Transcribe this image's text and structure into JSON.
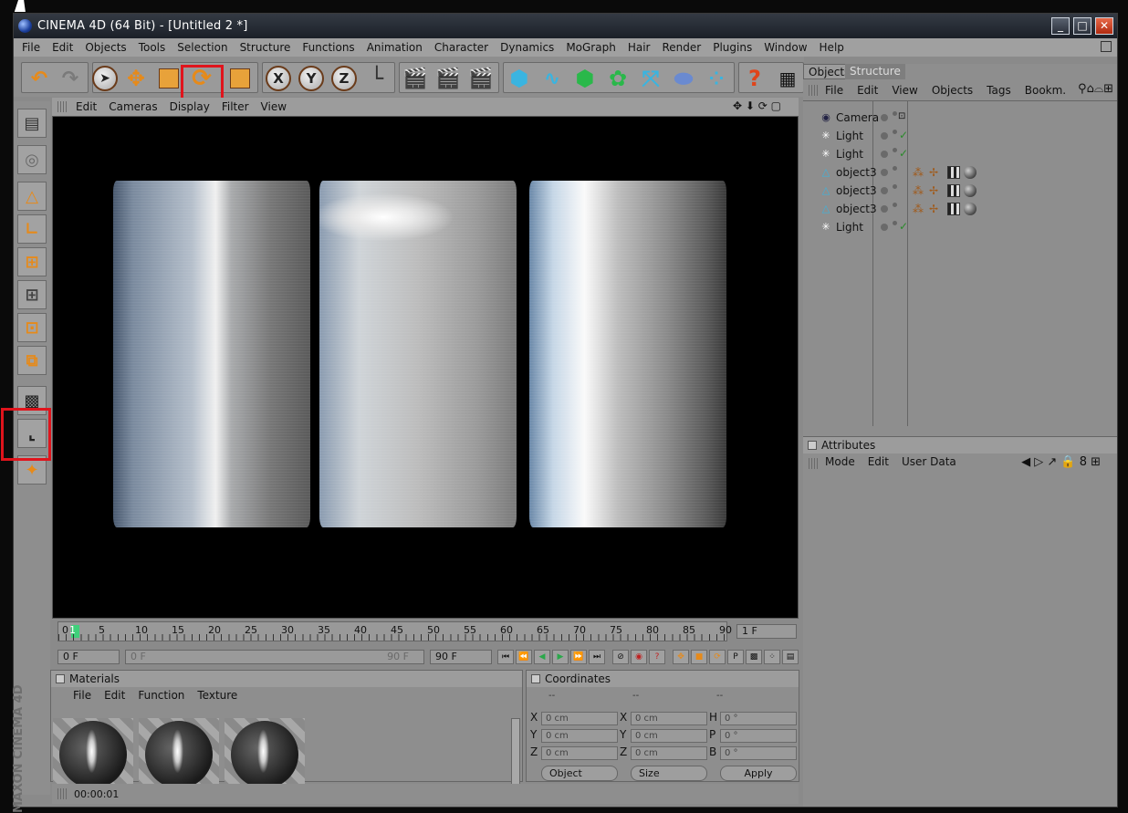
{
  "window": {
    "title": "CINEMA 4D (64 Bit) - [Untitled 2 *]",
    "minimize": "_",
    "maximize": "□",
    "close": "✕"
  },
  "menubar": [
    "File",
    "Edit",
    "Objects",
    "Tools",
    "Selection",
    "Structure",
    "Functions",
    "Animation",
    "Character",
    "Dynamics",
    "MoGraph",
    "Hair",
    "Render",
    "Plugins",
    "Window",
    "Help"
  ],
  "toolbar": {
    "axis_x": "X",
    "axis_y": "Y",
    "axis_z": "Z",
    "help_icon": "?"
  },
  "viewport": {
    "menu": [
      "Edit",
      "Cameras",
      "Display",
      "Filter",
      "View"
    ]
  },
  "timeline": {
    "ticks": [
      "0",
      "1",
      "5",
      "10",
      "15",
      "20",
      "25",
      "30",
      "35",
      "40",
      "45",
      "50",
      "55",
      "60",
      "65",
      "70",
      "75",
      "80",
      "85",
      "90"
    ],
    "current_frame": "1 F",
    "start": "0 F",
    "range_start": "0 F",
    "range_end": "90 F",
    "end": "90 F",
    "key_p": "P"
  },
  "materials": {
    "title": "Materials",
    "menu": [
      "File",
      "Edit",
      "Function",
      "Texture"
    ]
  },
  "coordinates": {
    "title": "Coordinates",
    "headers": [
      "--",
      "--",
      "--"
    ],
    "rows": [
      {
        "l1": "X",
        "v1": "0 cm",
        "l2": "X",
        "v2": "0 cm",
        "l3": "H",
        "v3": "0 °"
      },
      {
        "l1": "Y",
        "v1": "0 cm",
        "l2": "Y",
        "v2": "0 cm",
        "l3": "P",
        "v3": "0 °"
      },
      {
        "l1": "Z",
        "v1": "0 cm",
        "l2": "Z",
        "v2": "0 cm",
        "l3": "B",
        "v3": "0 °"
      }
    ],
    "mode": "Object",
    "size": "Size",
    "apply": "Apply"
  },
  "objects_panel": {
    "tabs": [
      "Objects",
      "Structure"
    ],
    "menu": [
      "File",
      "Edit",
      "View",
      "Objects",
      "Tags",
      "Bookm."
    ],
    "items": [
      {
        "name": "Camera",
        "type": "camera-icon"
      },
      {
        "name": "Light",
        "type": "light-icon"
      },
      {
        "name": "Light",
        "type": "light-icon"
      },
      {
        "name": "object3",
        "type": "object-icon"
      },
      {
        "name": "object3",
        "type": "object-icon"
      },
      {
        "name": "object3",
        "type": "object-icon"
      },
      {
        "name": "Light",
        "type": "light-icon"
      }
    ]
  },
  "attributes": {
    "title": "Attributes",
    "menu": [
      "Mode",
      "Edit",
      "User Data"
    ]
  },
  "status": {
    "time": "00:00:01"
  },
  "brand": "MAXON CINEMA 4D"
}
